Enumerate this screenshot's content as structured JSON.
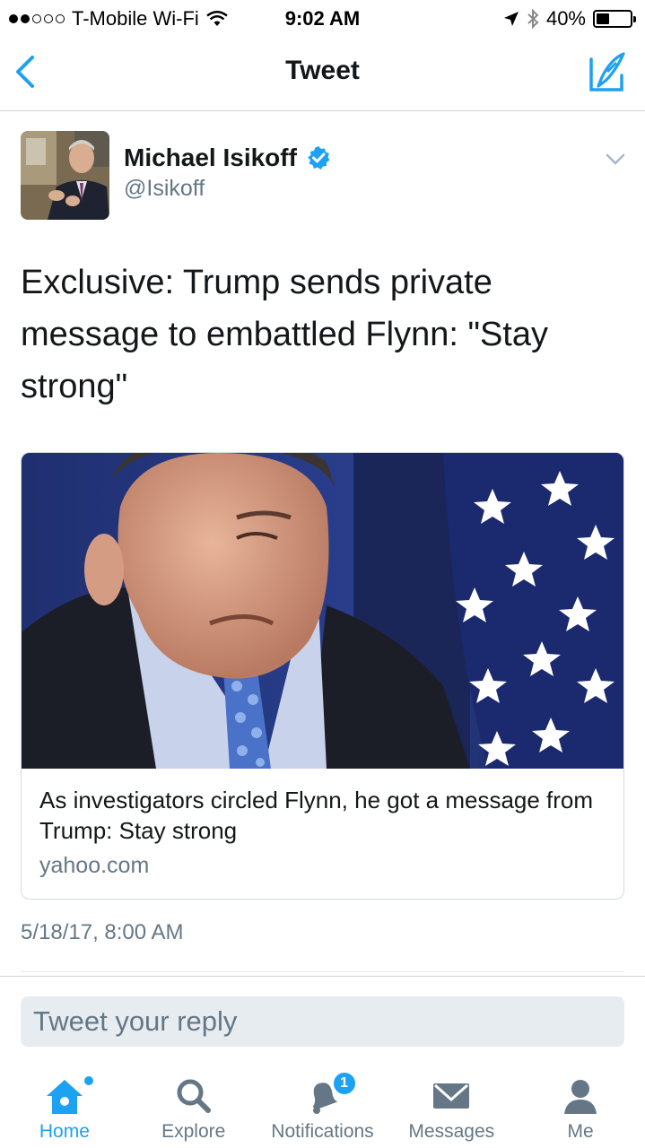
{
  "status_bar": {
    "carrier": "T-Mobile Wi-Fi",
    "time": "9:02 AM",
    "battery": "40%",
    "battery_level": 0.4,
    "signal_bars_filled": 2,
    "signal_bars_total": 5
  },
  "nav": {
    "title": "Tweet",
    "back_icon": "chevron-left-icon",
    "compose_icon": "compose-icon"
  },
  "tweet": {
    "author_name": "Michael Isikoff",
    "author_handle": "@Isikoff",
    "verified": true,
    "text": "Exclusive: Trump sends private message to embattled Flynn: \"Stay strong\"",
    "timestamp": "5/18/17, 8:00 AM",
    "card": {
      "title": "As investigators circled Flynn, he got a message from Trump: Stay strong",
      "domain": "yahoo.com"
    }
  },
  "reply": {
    "placeholder": "Tweet your reply"
  },
  "tabbar": {
    "items": [
      {
        "label": "Home",
        "icon": "home-icon",
        "active": true
      },
      {
        "label": "Explore",
        "icon": "search-icon",
        "active": false
      },
      {
        "label": "Notifications",
        "icon": "bell-icon",
        "active": false,
        "badge": "1"
      },
      {
        "label": "Messages",
        "icon": "envelope-icon",
        "active": false
      },
      {
        "label": "Me",
        "icon": "person-icon",
        "active": false
      }
    ]
  },
  "colors": {
    "accent": "#1da1f2",
    "text_primary": "#14171a",
    "text_secondary": "#657786",
    "reply_bg": "#e6ecf0"
  }
}
